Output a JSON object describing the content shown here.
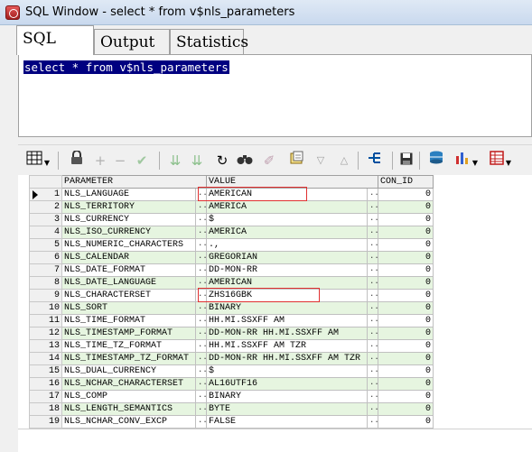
{
  "window": {
    "title": "SQL Window - select * from v$nls_parameters"
  },
  "tabs": [
    {
      "label": "SQL",
      "active": true
    },
    {
      "label": "Output",
      "active": false
    },
    {
      "label": "Statistics",
      "active": false
    }
  ],
  "editor": {
    "sql": "select * from v$nls_parameters"
  },
  "toolbar": {
    "icons": [
      "grid-view-icon",
      "lock-icon",
      "add-record-icon",
      "delete-record-icon",
      "post-icon",
      "fetch-next-icon",
      "fetch-last-icon",
      "refresh-icon",
      "find-icon",
      "clear-icon",
      "query-by-example-icon",
      "next-icon",
      "previous-icon",
      "sql-tree-icon",
      "save-icon",
      "export-icon",
      "chart-icon",
      "table-icon"
    ]
  },
  "grid": {
    "columns": [
      "PARAMETER",
      "VALUE",
      "CON_ID"
    ],
    "dots": "···",
    "rows": [
      {
        "n": "1",
        "parameter": "NLS_LANGUAGE",
        "value": "AMERICAN",
        "con_id": "0"
      },
      {
        "n": "2",
        "parameter": "NLS_TERRITORY",
        "value": "AMERICA",
        "con_id": "0"
      },
      {
        "n": "3",
        "parameter": "NLS_CURRENCY",
        "value": "$",
        "con_id": "0"
      },
      {
        "n": "4",
        "parameter": "NLS_ISO_CURRENCY",
        "value": "AMERICA",
        "con_id": "0"
      },
      {
        "n": "5",
        "parameter": "NLS_NUMERIC_CHARACTERS",
        "value": ".,",
        "con_id": "0"
      },
      {
        "n": "6",
        "parameter": "NLS_CALENDAR",
        "value": "GREGORIAN",
        "con_id": "0"
      },
      {
        "n": "7",
        "parameter": "NLS_DATE_FORMAT",
        "value": "DD-MON-RR",
        "con_id": "0"
      },
      {
        "n": "8",
        "parameter": "NLS_DATE_LANGUAGE",
        "value": "AMERICAN",
        "con_id": "0"
      },
      {
        "n": "9",
        "parameter": "NLS_CHARACTERSET",
        "value": "ZHS16GBK",
        "con_id": "0"
      },
      {
        "n": "10",
        "parameter": "NLS_SORT",
        "value": "BINARY",
        "con_id": "0"
      },
      {
        "n": "11",
        "parameter": "NLS_TIME_FORMAT",
        "value": "HH.MI.SSXFF AM",
        "con_id": "0"
      },
      {
        "n": "12",
        "parameter": "NLS_TIMESTAMP_FORMAT",
        "value": "DD-MON-RR HH.MI.SSXFF AM",
        "con_id": "0"
      },
      {
        "n": "13",
        "parameter": "NLS_TIME_TZ_FORMAT",
        "value": "HH.MI.SSXFF AM TZR",
        "con_id": "0"
      },
      {
        "n": "14",
        "parameter": "NLS_TIMESTAMP_TZ_FORMAT",
        "value": "DD-MON-RR HH.MI.SSXFF AM TZR",
        "con_id": "0"
      },
      {
        "n": "15",
        "parameter": "NLS_DUAL_CURRENCY",
        "value": "$",
        "con_id": "0"
      },
      {
        "n": "16",
        "parameter": "NLS_NCHAR_CHARACTERSET",
        "value": "AL16UTF16",
        "con_id": "0"
      },
      {
        "n": "17",
        "parameter": "NLS_COMP",
        "value": "BINARY",
        "con_id": "0"
      },
      {
        "n": "18",
        "parameter": "NLS_LENGTH_SEMANTICS",
        "value": "BYTE",
        "con_id": "0"
      },
      {
        "n": "19",
        "parameter": "NLS_NCHAR_CONV_EXCP",
        "value": "FALSE",
        "con_id": "0"
      }
    ]
  },
  "colors": {
    "selection": "#000080",
    "row_alt": "#e6f5e0",
    "highlight_box": "#e03030"
  }
}
